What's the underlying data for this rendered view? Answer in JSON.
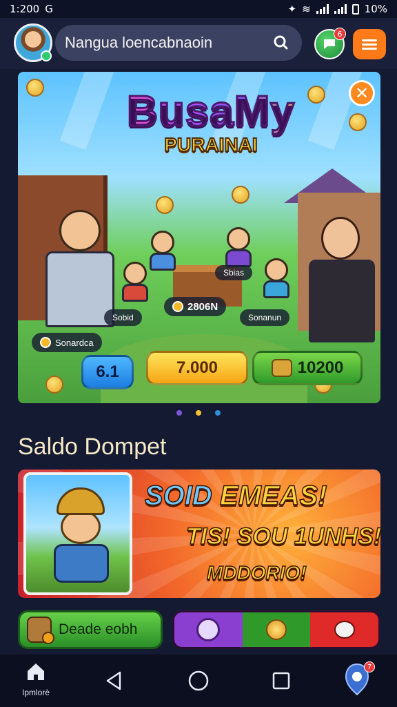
{
  "status_bar": {
    "time": "1:200",
    "left_extra": "G",
    "battery_text": "10%"
  },
  "header": {
    "search_text": "Nangua loencabnaoin",
    "chat_badge": "6",
    "icons": [
      "avatar",
      "search-icon",
      "chat-icon",
      "menu-icon"
    ]
  },
  "banner": {
    "title_line1": "BusaMy",
    "title_line2": "PURAINAI",
    "tags": {
      "left_name": "Sonardca",
      "center_left": "Sobid",
      "center_right": "Sbias",
      "center_value": "2806N",
      "right_name": "Sonanun"
    },
    "buttons": {
      "blue": "6.1",
      "yellow": "7.000",
      "green": "10200"
    },
    "carousel_dots": [
      "#7a55d6",
      "#f2c230",
      "#2f8fd6"
    ]
  },
  "wallet": {
    "section_title": "Saldo Dompet"
  },
  "promo": {
    "line1_blue": "SOID",
    "line1_yellow": " EMEAS!",
    "line2": "TIS! SOU 1UNHS!",
    "line3": "MDDORIO!"
  },
  "actions": {
    "left_label": "Deade eobh"
  },
  "nav": {
    "home_label": "Ipmlorè",
    "profile_badge": "7"
  },
  "colors": {
    "background": "#151a33",
    "accent_orange": "#ff7a18",
    "accent_green": "#2f9a2a",
    "accent_red": "#e02a2a",
    "accent_purple": "#8a3fd1"
  }
}
